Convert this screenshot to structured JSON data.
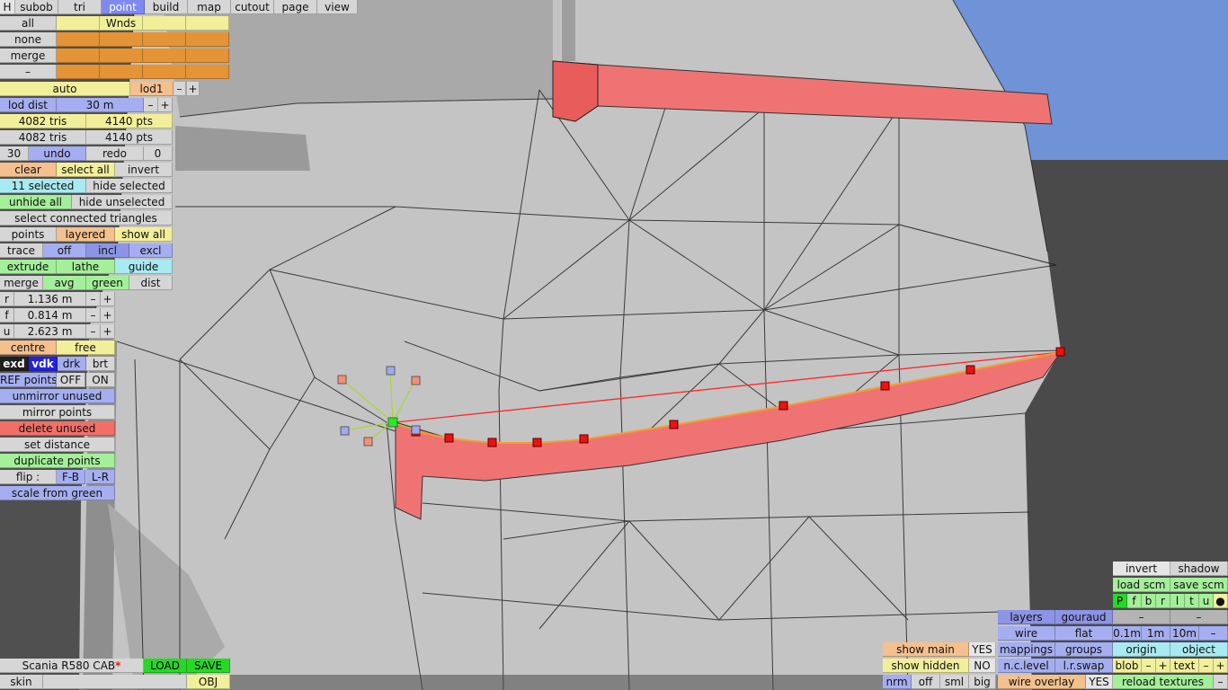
{
  "menu": {
    "h": "H",
    "items": [
      "subob",
      "tri",
      "point",
      "build",
      "map",
      "cutout",
      "page",
      "view"
    ]
  },
  "sel_panel": {
    "all": "all",
    "none": "none",
    "merge": "merge",
    "minus": "–",
    "wnds": "Wnds"
  },
  "lod": {
    "auto": "auto",
    "lod1": "lod1",
    "minus": "–",
    "plus": "+",
    "dist_label": "lod dist",
    "dist_value": "30 m"
  },
  "stats": {
    "tris1": "4082 tris",
    "pts1": "4140 pts",
    "tris2": "4082 tris",
    "pts2": "4140 pts"
  },
  "history": {
    "count": "30",
    "undo": "undo",
    "redo": "redo",
    "redo_count": "0"
  },
  "selection": {
    "clear": "clear",
    "select_all": "select all",
    "invert": "invert",
    "selected": "11 selected",
    "hide_selected": "hide selected",
    "unhide_all": "unhide all",
    "hide_unselected": "hide unselected",
    "select_connected": "select connected triangles"
  },
  "mode": {
    "points": "points",
    "layered": "layered",
    "show_all": "show all"
  },
  "trace": {
    "trace": "trace",
    "off": "off",
    "incl": "incl",
    "excl": "excl"
  },
  "tools": {
    "extrude": "extrude",
    "lathe": "lathe",
    "guide": "guide",
    "merge": "merge",
    "avg": "avg",
    "green": "green",
    "dist": "dist"
  },
  "coords": [
    {
      "axis": "r",
      "value": "1.136 m"
    },
    {
      "axis": "f",
      "value": "0.814 m"
    },
    {
      "axis": "u",
      "value": "2.623 m"
    }
  ],
  "pm": {
    "minus": "–",
    "plus": "+"
  },
  "pivot": {
    "centre": "centre",
    "free": "free"
  },
  "view_modes": {
    "exd": "exd",
    "vdk": "vdk",
    "drk": "drk",
    "brt": "brt"
  },
  "ref": {
    "label": "REF points",
    "off": "OFF",
    "on": "ON"
  },
  "actions": {
    "unmirror_unused": "unmirror unused",
    "mirror_points": "mirror points",
    "delete_unused": "delete unused",
    "set_distance": "set distance",
    "duplicate_points": "duplicate points",
    "flip": "flip :",
    "fb": "F-B",
    "lr": "L-R",
    "scale_from_green": "scale from green"
  },
  "file": {
    "name": "Scania R580 CAB",
    "star": "*",
    "load": "LOAD",
    "save": "SAVE",
    "skin": "skin",
    "obj": "OBJ"
  },
  "bottom_mid": {
    "show_main": "show main",
    "show_main_val": "YES",
    "show_hidden": "show hidden",
    "show_hidden_val": "NO",
    "nrm": "nrm",
    "off": "off",
    "sml": "sml",
    "big": "big"
  },
  "render": {
    "layers": "layers",
    "gouraud": "gouraud",
    "wire": "wire",
    "flat": "flat",
    "mappings": "mappings",
    "groups": "groups",
    "nclevel": "n.c.level",
    "lrswap": "l.r.swap",
    "wire_overlay": "wire overlay",
    "wire_overlay_val": "YES"
  },
  "right_panel": {
    "invert": "invert",
    "shadow": "shadow",
    "load_scm": "load scm",
    "save_scm": "save scm",
    "flags": [
      "P",
      "f",
      "b",
      "r",
      "l",
      "t",
      "u"
    ],
    "dot": "●",
    "dash1": "–",
    "dash2": "–",
    "g01": "0.1m",
    "g1": "1m",
    "g10": "10m",
    "gminus": "–",
    "origin": "origin",
    "object": "object",
    "blob": "blob",
    "text": "text",
    "reload": "reload textures",
    "rminus": "–"
  },
  "colors": {
    "highlight": "#f07373",
    "edge": "#222222",
    "mesh": "#c4c4c4",
    "sky": "#6f93d6",
    "ground": "#4a4a4a"
  }
}
